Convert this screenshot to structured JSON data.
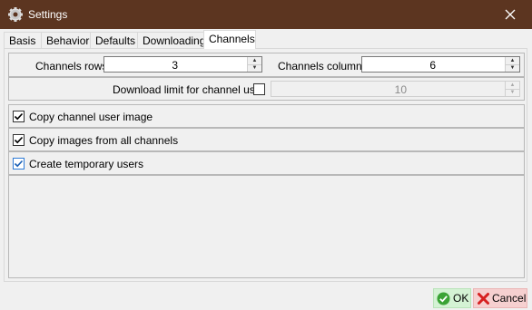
{
  "window": {
    "title": "Settings",
    "icon": "gear-icon",
    "close_icon": "close-icon"
  },
  "tabs": [
    {
      "label": "Basis"
    },
    {
      "label": "Behavior"
    },
    {
      "label": "Defaults"
    },
    {
      "label": "Downloading"
    },
    {
      "label": "Channels",
      "active": true
    }
  ],
  "channels": {
    "rows_label": "Channels rows",
    "rows_value": "3",
    "columns_label": "Channels columns",
    "columns_value": "6",
    "download_limit_label": "Download limit for channel user",
    "download_limit_enabled": false,
    "download_limit_value": "10",
    "options": [
      {
        "label": "Copy channel user image",
        "checked": true
      },
      {
        "label": "Copy images from all channels",
        "checked": true
      },
      {
        "label": "Create temporary users",
        "checked": true,
        "focused": true
      }
    ]
  },
  "footer": {
    "ok_label": "OK",
    "cancel_label": "Cancel"
  },
  "colors": {
    "titlebar": "#5c3520",
    "ok_bg": "#d4f2d4",
    "cancel_bg": "#f6d0d0",
    "ok_icon": "#3aa335",
    "cancel_icon": "#d62020"
  }
}
